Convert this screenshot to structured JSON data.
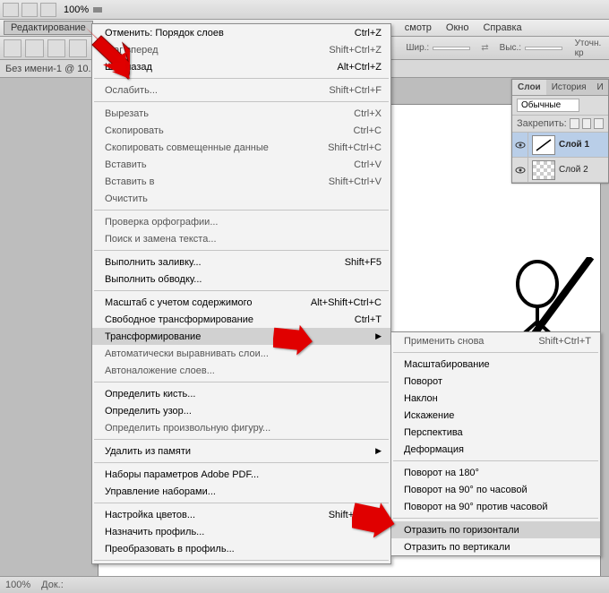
{
  "toolbar": {
    "zoom": "100%"
  },
  "menubar": {
    "edit": "Редактирование",
    "view": "смотр",
    "window": "Окно",
    "help": "Справка"
  },
  "options": {
    "width_label": "Шир.:",
    "height_label": "Выс.:",
    "refine": "Уточн. кр"
  },
  "doc": {
    "tab": "Без имени-1 @ 10..."
  },
  "status": {
    "zoom": "100%",
    "doc": "Док.:"
  },
  "main_menu": [
    {
      "label": "Отменить: Порядок слоев",
      "shortcut": "Ctrl+Z",
      "enabled": true
    },
    {
      "label": "Шаг вперед",
      "shortcut": "Shift+Ctrl+Z",
      "enabled": false
    },
    {
      "label": "Шаг назад",
      "shortcut": "Alt+Ctrl+Z",
      "enabled": true
    },
    {
      "sep": true
    },
    {
      "label": "Ослабить...",
      "shortcut": "Shift+Ctrl+F",
      "enabled": false
    },
    {
      "sep": true
    },
    {
      "label": "Вырезать",
      "shortcut": "Ctrl+X",
      "enabled": false
    },
    {
      "label": "Скопировать",
      "shortcut": "Ctrl+C",
      "enabled": false
    },
    {
      "label": "Скопировать совмещенные данные",
      "shortcut": "Shift+Ctrl+C",
      "enabled": false
    },
    {
      "label": "Вставить",
      "shortcut": "Ctrl+V",
      "enabled": false
    },
    {
      "label": "Вставить в",
      "shortcut": "Shift+Ctrl+V",
      "enabled": false
    },
    {
      "label": "Очистить",
      "shortcut": "",
      "enabled": false
    },
    {
      "sep": true
    },
    {
      "label": "Проверка орфографии...",
      "shortcut": "",
      "enabled": false
    },
    {
      "label": "Поиск и замена текста...",
      "shortcut": "",
      "enabled": false
    },
    {
      "sep": true
    },
    {
      "label": "Выполнить заливку...",
      "shortcut": "Shift+F5",
      "enabled": true
    },
    {
      "label": "Выполнить обводку...",
      "shortcut": "",
      "enabled": true
    },
    {
      "sep": true
    },
    {
      "label": "Масштаб с учетом содержимого",
      "shortcut": "Alt+Shift+Ctrl+C",
      "enabled": true
    },
    {
      "label": "Свободное трансформирование",
      "shortcut": "Ctrl+T",
      "enabled": true
    },
    {
      "label": "Трансформирование",
      "shortcut": "",
      "enabled": true,
      "sub": true,
      "hl": true
    },
    {
      "label": "Автоматически выравнивать слои...",
      "shortcut": "",
      "enabled": false
    },
    {
      "label": "Автоналожение слоев...",
      "shortcut": "",
      "enabled": false
    },
    {
      "sep": true
    },
    {
      "label": "Определить кисть...",
      "shortcut": "",
      "enabled": true
    },
    {
      "label": "Определить узор...",
      "shortcut": "",
      "enabled": true
    },
    {
      "label": "Определить произвольную фигуру...",
      "shortcut": "",
      "enabled": false
    },
    {
      "sep": true
    },
    {
      "label": "Удалить из памяти",
      "shortcut": "",
      "enabled": true,
      "sub": true
    },
    {
      "sep": true
    },
    {
      "label": "Наборы параметров Adobe PDF...",
      "shortcut": "",
      "enabled": true
    },
    {
      "label": "Управление наборами...",
      "shortcut": "",
      "enabled": true
    },
    {
      "sep": true
    },
    {
      "label": "Настройка цветов...",
      "shortcut": "Shift+Ctrl+K",
      "enabled": true
    },
    {
      "label": "Назначить профиль...",
      "shortcut": "",
      "enabled": true
    },
    {
      "label": "Преобразовать в профиль...",
      "shortcut": "",
      "enabled": true
    },
    {
      "sep": true
    }
  ],
  "sub_menu": [
    {
      "label": "Применить снова",
      "shortcut": "Shift+Ctrl+T",
      "enabled": false
    },
    {
      "sep": true
    },
    {
      "label": "Масштабирование",
      "enabled": true
    },
    {
      "label": "Поворот",
      "enabled": true
    },
    {
      "label": "Наклон",
      "enabled": true
    },
    {
      "label": "Искажение",
      "enabled": true
    },
    {
      "label": "Перспектива",
      "enabled": true
    },
    {
      "label": "Деформация",
      "enabled": true
    },
    {
      "sep": true
    },
    {
      "label": "Поворот на 180°",
      "enabled": true
    },
    {
      "label": "Поворот на 90° по часовой",
      "enabled": true
    },
    {
      "label": "Поворот на 90° против часовой",
      "enabled": true
    },
    {
      "sep": true
    },
    {
      "label": "Отразить по горизонтали",
      "enabled": true,
      "hl": true
    },
    {
      "label": "Отразить по вертикали",
      "enabled": true
    }
  ],
  "layers": {
    "tab_layers": "Слои",
    "tab_history": "История",
    "tab_info": "И",
    "blend": "Обычные",
    "lock_label": "Закрепить:",
    "items": [
      {
        "name": "Слой 1",
        "active": true
      },
      {
        "name": "Слой 2",
        "active": false
      }
    ]
  }
}
